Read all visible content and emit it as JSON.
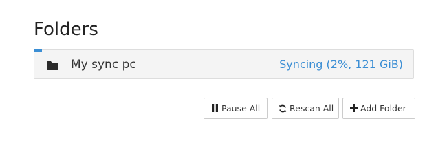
{
  "section": {
    "title": "Folders"
  },
  "folders": [
    {
      "icon": "folder-icon",
      "name": "My sync pc",
      "status": "Syncing (2%, 121 GiB)",
      "progress_percent": 2
    }
  ],
  "actions": {
    "pause_all": {
      "icon": "pause-icon",
      "label": "Pause All"
    },
    "rescan_all": {
      "icon": "refresh-icon",
      "label": "Rescan All"
    },
    "add_folder": {
      "icon": "plus-icon",
      "label": "Add Folder"
    }
  },
  "colors": {
    "accent": "#3b8ed4",
    "panel_bg": "#f4f4f4",
    "border": "#dddddd"
  }
}
